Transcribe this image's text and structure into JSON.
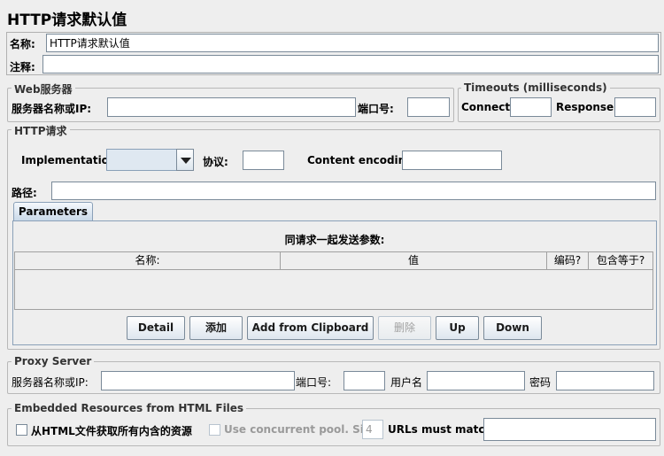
{
  "title": "HTTP请求默认值",
  "name_label": "名称:",
  "name_value": "HTTP请求默认值",
  "comment_label": "注释:",
  "comment_value": "",
  "web_server": {
    "legend": "Web服务器",
    "server_label": "服务器名称或IP:",
    "server_value": "",
    "port_label": "端口号:",
    "port_value": ""
  },
  "timeouts": {
    "legend": "Timeouts (milliseconds)",
    "connect_label": "Connect:",
    "connect_value": "",
    "response_label": "Response:",
    "response_value": ""
  },
  "http_request": {
    "legend": "HTTP请求",
    "implementation_label": "Implementation:",
    "implementation_value": "",
    "protocol_label": "协议:",
    "protocol_value": "",
    "encoding_label": "Content encoding:",
    "encoding_value": "",
    "path_label": "路径:",
    "path_value": ""
  },
  "parameters": {
    "tab_label": "Parameters",
    "caption": "同请求一起发送参数:",
    "columns": [
      "名称:",
      "值",
      "编码?",
      "包含等于?"
    ],
    "rows": [],
    "buttons": {
      "detail": "Detail",
      "add": "添加",
      "add_clipboard": "Add from Clipboard",
      "delete": "删除",
      "up": "Up",
      "down": "Down"
    }
  },
  "proxy": {
    "legend": "Proxy Server",
    "server_label": "服务器名称或IP:",
    "server_value": "",
    "port_label": "端口号:",
    "port_value": "",
    "user_label": "用户名",
    "user_value": "",
    "password_label": "密码",
    "password_value": ""
  },
  "embedded": {
    "legend": "Embedded Resources from HTML Files",
    "retrieve_label": "从HTML文件获取所有内含的资源",
    "retrieve_checked": false,
    "concurrent_label": "Use concurrent pool. Size:",
    "concurrent_checked": false,
    "pool_size": "4",
    "urls_label": "URLs must match:",
    "urls_value": ""
  }
}
